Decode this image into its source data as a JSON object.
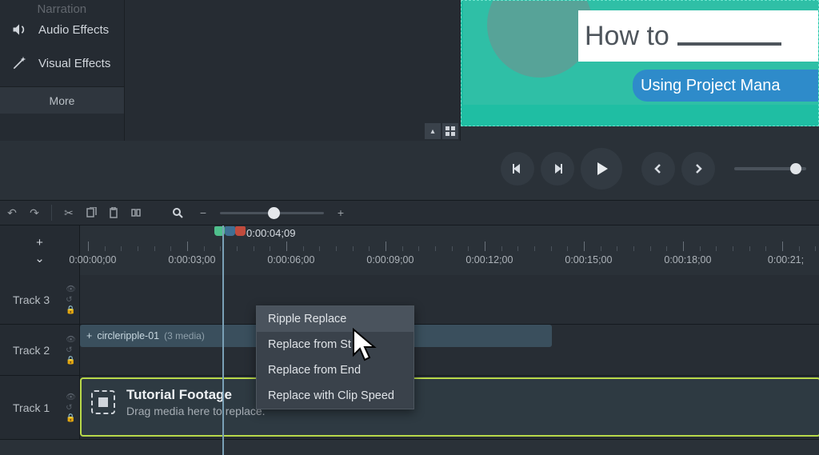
{
  "tools": {
    "items": [
      {
        "label": "Voice Narration"
      },
      {
        "label": "Audio Effects"
      },
      {
        "label": "Visual Effects"
      }
    ],
    "more": "More"
  },
  "preview": {
    "title": "How to",
    "subtitle": "Using Project Mana"
  },
  "playhead": {
    "time": "0:00:04;09"
  },
  "ruler": {
    "labels": [
      "0:00:00;00",
      "0:00:03;00",
      "0:00:06;00",
      "0:00:09;00",
      "0:00:12;00",
      "0:00:15;00",
      "0:00:18;00",
      "0:00:21;"
    ]
  },
  "tracks": {
    "t3": "Track 3",
    "t2": "Track 2",
    "t1": "Track 1"
  },
  "clips": {
    "ripple": {
      "name": "circleripple-01",
      "meta": "(3 media)"
    },
    "placeholder": {
      "title": "Tutorial Footage",
      "hint": "Drag media here to replace."
    }
  },
  "context_menu": {
    "items": [
      "Ripple Replace",
      "Replace from St",
      "Replace from End",
      "Replace with Clip Speed"
    ]
  }
}
